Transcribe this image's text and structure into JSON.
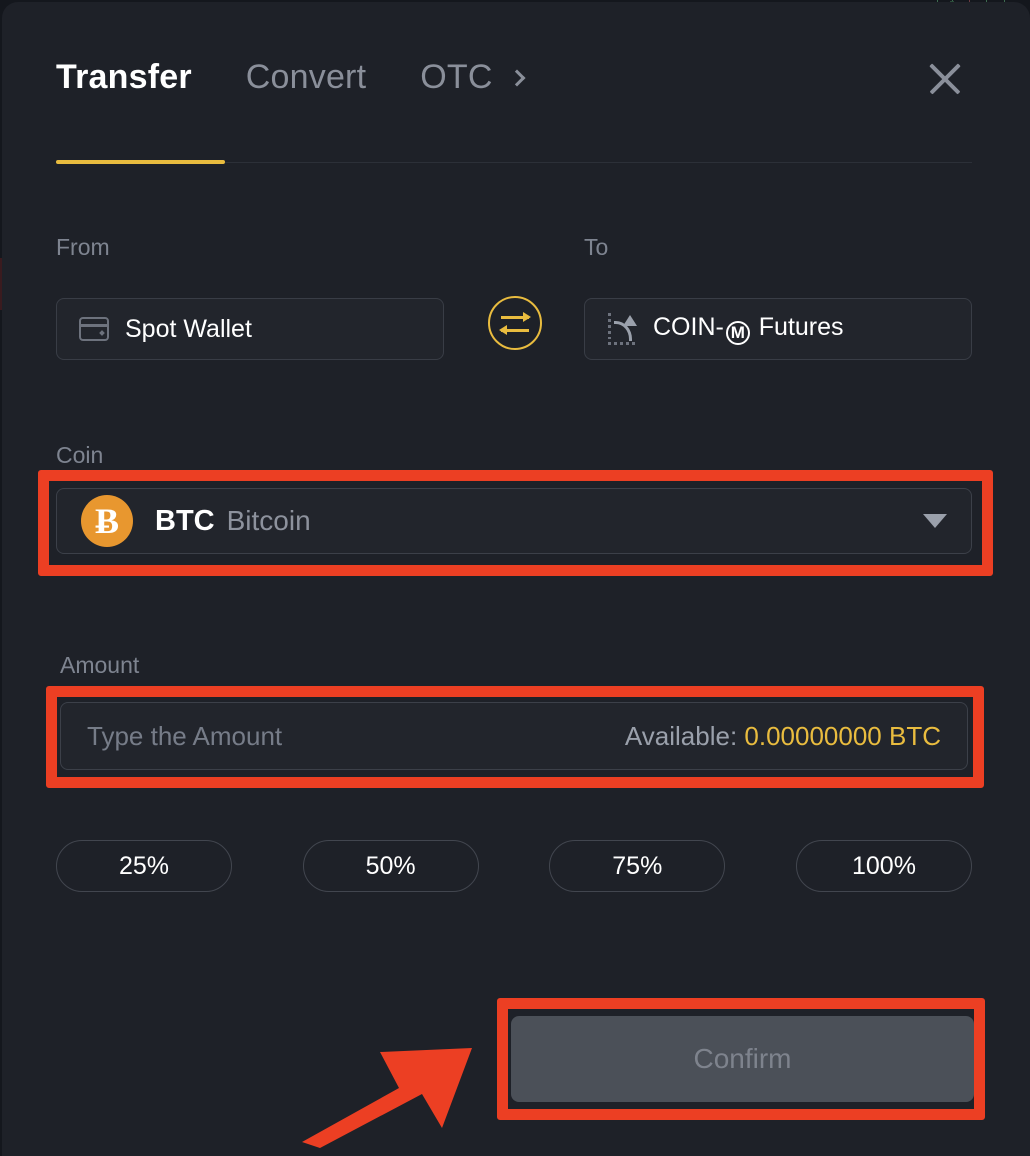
{
  "window": {
    "title": "Transfer"
  },
  "header": {
    "tabs": [
      {
        "label": "Transfer",
        "active": true,
        "name": "tab-transfer"
      },
      {
        "label": "Convert",
        "active": false,
        "name": "tab-convert"
      },
      {
        "label": "OTC",
        "active": false,
        "name": "tab-otc",
        "chevron": "chevron-right-icon"
      }
    ],
    "close_icon": "close-icon",
    "active_tab_accent": "#e9bc3f"
  },
  "transfer": {
    "from": {
      "label": "From",
      "value": "Spot Wallet",
      "icon": "wallet-icon"
    },
    "to": {
      "label": "To",
      "value_prefix": "COIN-",
      "value_badge": "M",
      "value_suffix": "Futures",
      "value_full": "COIN-M Futures",
      "icon": "futures-chart-icon"
    },
    "swap_icon": "swap-arrows-icon",
    "coin": {
      "label": "Coin",
      "symbol": "BTC",
      "name": "Bitcoin",
      "logo_glyph": "Ƀ",
      "logo_color": "#e8972f",
      "caret_icon": "caret-down-icon"
    },
    "amount": {
      "label": "Amount",
      "value": "",
      "placeholder": "Type the Amount",
      "available_label": "Available:",
      "available_value": "0.00000000 BTC",
      "available_color": "#e9bc3f"
    },
    "percent_buttons": [
      "25%",
      "50%",
      "75%",
      "100%"
    ],
    "confirm": {
      "label": "Confirm",
      "disabled": true
    }
  },
  "annotations": {
    "highlight_color": "#ec3f23",
    "boxes": [
      "coin-select",
      "amount-input",
      "confirm-button"
    ],
    "arrow": "points at confirm-button"
  }
}
